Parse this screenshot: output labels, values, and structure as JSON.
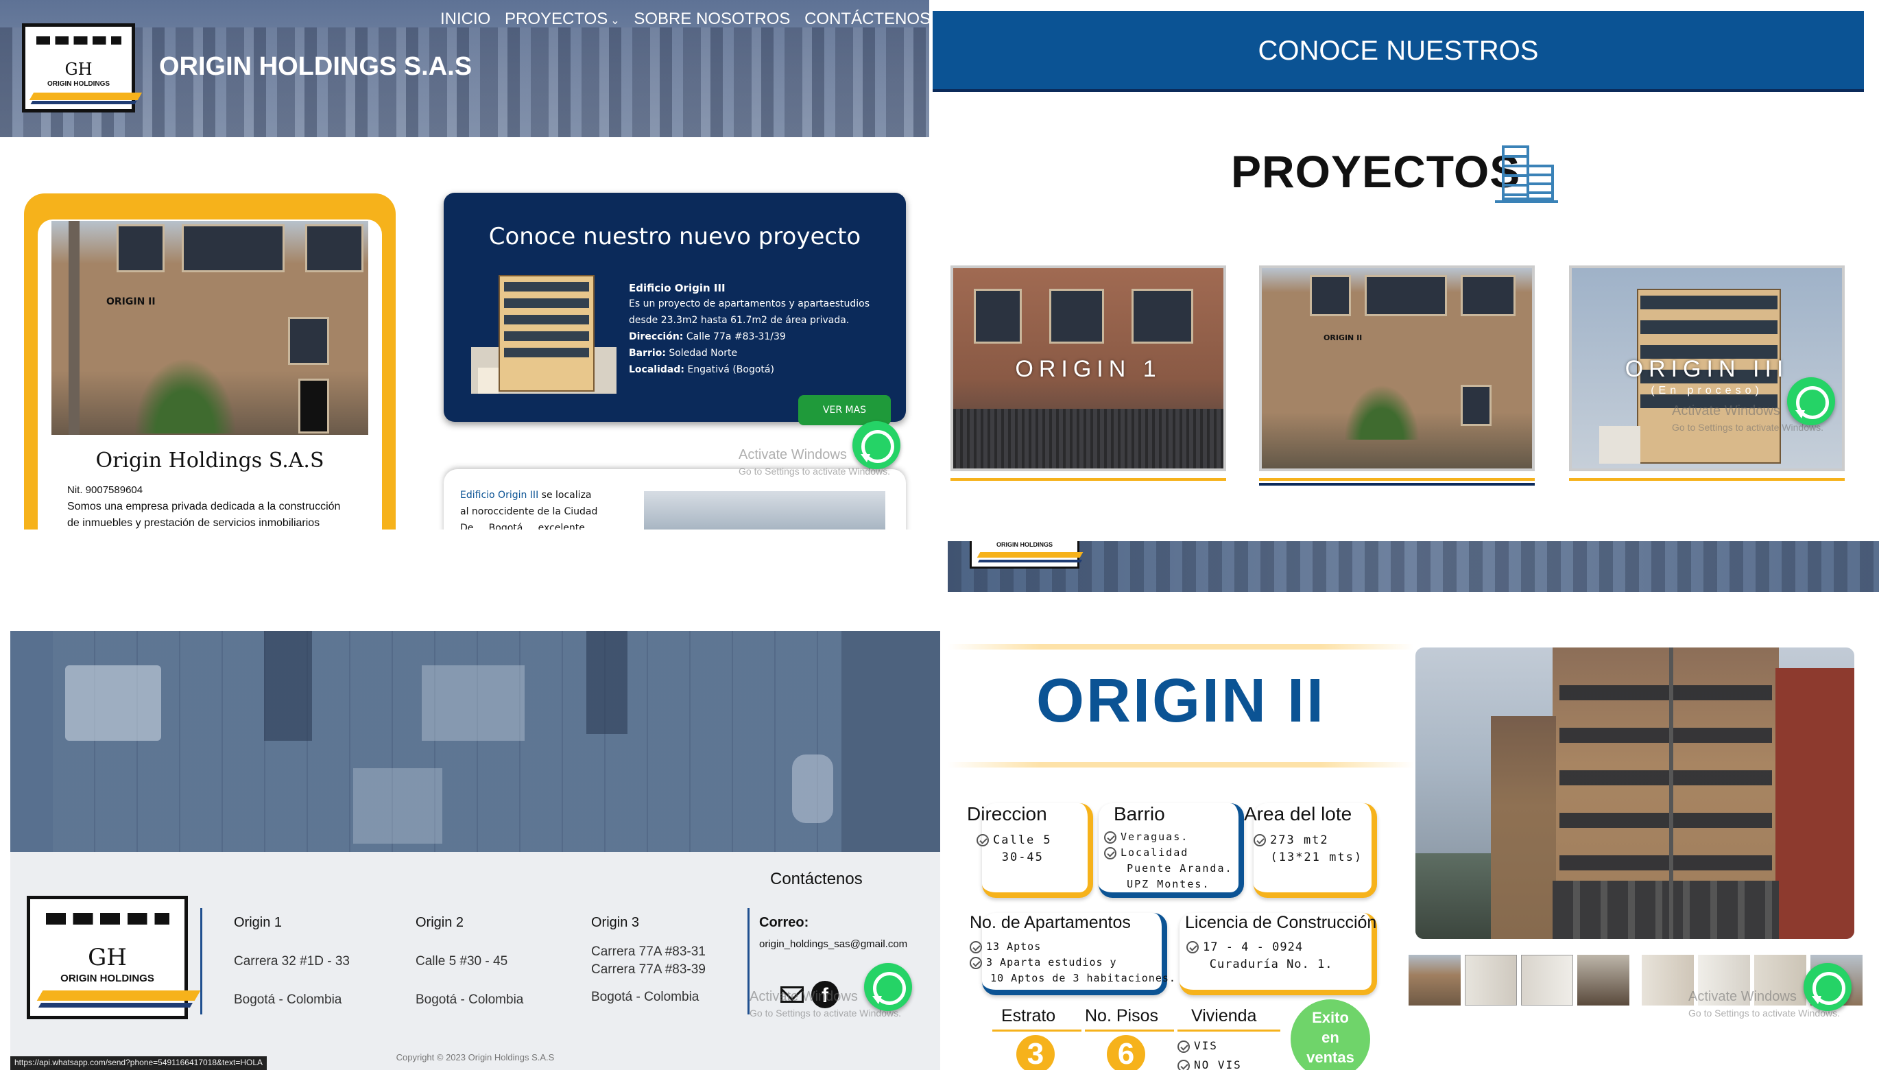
{
  "panel1": {
    "nav": {
      "inicio": "INICIO",
      "proyectos": "PROYECTOS",
      "sobre": "SOBRE NOSOTROS",
      "contacto": "CONTÁCTENOS"
    },
    "site_title": "ORIGIN HOLDINGS S.A.S",
    "logo_text": "ORIGIN HOLDINGS",
    "logo_initials": "GH",
    "card": {
      "title": "Origin Holdings S.A.S",
      "nit": "Nit. 9007589604",
      "desc_1": "Somos una empresa privada dedicada a la construcción",
      "desc_2": "de inmuebles y prestación de servicios inmobiliarios"
    },
    "promo": {
      "title": "Conoce nuestro nuevo proyecto",
      "name": "Edificio Origin III",
      "desc_1": "Es un proyecto de apartamentos y apartaestudios",
      "desc_2": "desde 23.3m2 hasta 61.7m2 de área privada.",
      "dir_label": "Dirección:",
      "dir_value": "Calle 77a #83-31/39",
      "barrio_label": "Barrio:",
      "barrio_value": "Soledad Norte",
      "loc_label": "Localidad:",
      "loc_value": "Engativá (Bogotá)",
      "button": "VER MAS"
    },
    "info": {
      "link": "Edificio Origin III",
      "line_1": "se localiza",
      "line_2": "al noroccidente de la Ciudad",
      "line_3a": "De",
      "line_3b": "Bogotá",
      "line_3c": "excelente"
    },
    "watermark": {
      "line1": "Activate Windows",
      "line2": "Go to Settings to activate Windows."
    }
  },
  "panel2": {
    "banner": "CONOCE NUESTROS",
    "heading": "PROYECTOS",
    "projects": [
      {
        "label": "ORIGIN 1",
        "sub": ""
      },
      {
        "label": "",
        "sub": ""
      },
      {
        "label": "ORIGIN III",
        "sub": "(En proceso)"
      }
    ],
    "watermark": {
      "line1": "Activate Windows",
      "line2": "Go to Settings to activate Windows."
    }
  },
  "panel3": {
    "contact_title": "Contáctenos",
    "logo_text": "ORIGIN HOLDINGS",
    "logo_initials": "GH",
    "columns": [
      {
        "title": "Origin 1",
        "addr_1": "Carrera 32 #1D - 33",
        "addr_2": "",
        "city": "Bogotá - Colombia"
      },
      {
        "title": "Origin 2",
        "addr_1": "Calle 5 #30 - 45",
        "addr_2": "",
        "city": "Bogotá - Colombia"
      },
      {
        "title": "Origin 3",
        "addr_1": "Carrera 77A #83-31",
        "addr_2": "Carrera 77A #83-39",
        "city": "Bogotá - Colombia"
      }
    ],
    "email_label": "Correo:",
    "email_value": "origin_holdings_sas@gmail.com",
    "copyright": "Copyright © 2023 Origin Holdings S.A.S",
    "status_url": "https://api.whatsapp.com/send?phone=5491166417018&text=HOLA",
    "watermark": {
      "line1": "Activate Windows",
      "line2": "Go to Settings to activate Windows."
    }
  },
  "panel4": {
    "title": "ORIGIN II",
    "direccion": {
      "title": "Direccion",
      "l1": "Calle 5",
      "l2": "30-45"
    },
    "barrio": {
      "title": "Barrio",
      "l1": "Veraguas.",
      "l2": "Localidad",
      "l3": "Puente Aranda.",
      "l4": "UPZ Montes."
    },
    "area": {
      "title": "Area del lote",
      "l1": "273 mt2",
      "l2": "(13*21 mts)"
    },
    "apartamentos": {
      "title": "No. de Apartamentos",
      "l1": "13 Aptos",
      "l2": "3 Aparta estudios y",
      "l3": "10 Aptos de 3 habitaciones."
    },
    "licencia": {
      "title": "Licencia de Construcción",
      "l1": "17 - 4 - 0924",
      "l2": "Curaduría No. 1."
    },
    "estrato": {
      "title": "Estrato",
      "value": "3"
    },
    "pisos": {
      "title": "No. Pisos",
      "value": "6"
    },
    "vivienda": {
      "title": "Vivienda",
      "l1": "VIS",
      "l2": "NO VIS"
    },
    "exito": {
      "l1": "Exito",
      "l2": "en",
      "l3": "ventas"
    },
    "logo_text": "ORIGIN HOLDINGS",
    "watermark": {
      "line1": "Activate Windows",
      "line2": "Go to Settings to activate Windows."
    }
  },
  "colors": {
    "navy": "#0b5394",
    "gold": "#f6b21b",
    "dark_navy": "#0b2a5a",
    "whatsapp": "#25d366",
    "green_btn": "#1f9a3a"
  }
}
